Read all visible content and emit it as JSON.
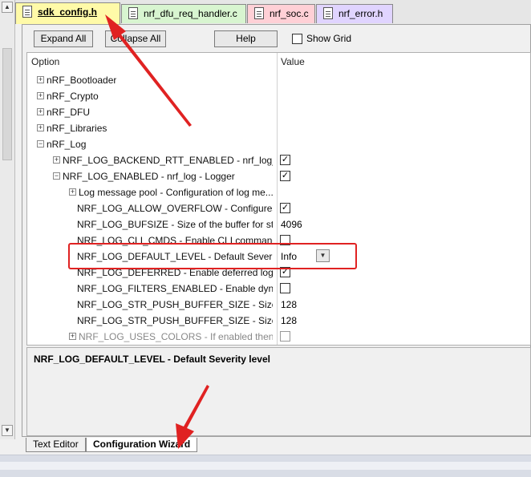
{
  "tabs": [
    {
      "label": "sdk_config.h",
      "active": true
    },
    {
      "label": "nrf_dfu_req_handler.c",
      "active": false
    },
    {
      "label": "nrf_soc.c",
      "active": false
    },
    {
      "label": "nrf_error.h",
      "active": false
    }
  ],
  "toolbar": {
    "expand_all": "Expand All",
    "collapse_all": "Collapse All",
    "help": "Help",
    "show_grid": "Show Grid",
    "show_grid_checked": false
  },
  "columns": {
    "option": "Option",
    "value": "Value"
  },
  "rows": [
    {
      "label": "nRF_Bootloader",
      "expander": "+",
      "value": "",
      "checkbox": null
    },
    {
      "label": "nRF_Crypto",
      "expander": "+",
      "value": "",
      "checkbox": null
    },
    {
      "label": "nRF_DFU",
      "expander": "+",
      "value": "",
      "checkbox": null
    },
    {
      "label": "nRF_Libraries",
      "expander": "+",
      "value": "",
      "checkbox": null
    },
    {
      "label": "nRF_Log",
      "expander": "−",
      "value": "",
      "checkbox": null
    },
    {
      "label": "NRF_LOG_BACKEND_RTT_ENABLED - nrf_log_ba...",
      "expander": "+",
      "value": "",
      "checkbox": true
    },
    {
      "label": "NRF_LOG_ENABLED - nrf_log - Logger",
      "expander": "−",
      "value": "",
      "checkbox": true
    },
    {
      "label": "Log message pool - Configuration of log me...",
      "expander": "+",
      "value": "",
      "checkbox": null
    },
    {
      "label": "NRF_LOG_ALLOW_OVERFLOW  - Configures ...",
      "expander": "",
      "value": "",
      "checkbox": true
    },
    {
      "label": "NRF_LOG_BUFSIZE  - Size of the buffer for st...",
      "expander": "",
      "value": "4096",
      "checkbox": null
    },
    {
      "label": "NRF_LOG_CLI_CMDS  - Enable CLI command...",
      "expander": "",
      "value": "",
      "checkbox": false
    },
    {
      "label": "NRF_LOG_DEFAULT_LEVEL  - Default Severity ...",
      "expander": "",
      "value": "Info",
      "checkbox": null
    },
    {
      "label": "NRF_LOG_DEFERRED  - Enable deferred logger...",
      "expander": "",
      "value": "",
      "checkbox": true
    },
    {
      "label": "NRF_LOG_FILTERS_ENABLED  - Enable dyna...",
      "expander": "",
      "value": "",
      "checkbox": false
    },
    {
      "label": "NRF_LOG_STR_PUSH_BUFFER_SIZE  - Size of t...",
      "expander": "",
      "value": "128",
      "checkbox": null
    },
    {
      "label": "NRF_LOG_STR_PUSH_BUFFER_SIZE  - Size of t...",
      "expander": "",
      "value": "128",
      "checkbox": null
    },
    {
      "label": "NRF_LOG_USES_COLORS - If enabled then A...",
      "expander": "+",
      "value": "",
      "checkbox": false
    }
  ],
  "description": "NRF_LOG_DEFAULT_LEVEL  - Default Severity level",
  "bottom_tabs": [
    {
      "label": "Text Editor",
      "active": false
    },
    {
      "label": "Configuration Wizard",
      "active": true
    }
  ],
  "colors": {
    "annotation": "#e02222",
    "active_tab": "#fffaa8"
  }
}
